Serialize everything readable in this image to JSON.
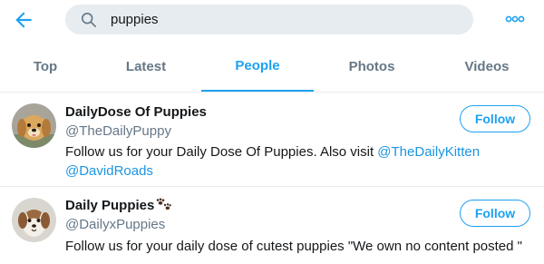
{
  "search": {
    "query": "puppies"
  },
  "tabs": [
    {
      "label": "Top"
    },
    {
      "label": "Latest"
    },
    {
      "label": "People",
      "active": true
    },
    {
      "label": "Photos"
    },
    {
      "label": "Videos"
    }
  ],
  "users": [
    {
      "name": "DailyDose Of Puppies",
      "handle": "@TheDailyPuppy",
      "bio_text": "Follow us for your Daily Dose Of Puppies. Also visit ",
      "bio_link_1": "@TheDailyKitten",
      "bio_link_2": "@DavidRoads",
      "follow_label": "Follow"
    },
    {
      "name": "Daily Puppies",
      "name_icon": "paw-prints-icon",
      "handle": "@DailyxPuppies",
      "bio_text": "Follow us for your daily dose of cutest puppies \"We own no content posted \"",
      "follow_label": "Follow"
    }
  ],
  "colors": {
    "accent": "#1da1f2",
    "link": "#1b95e0",
    "muted": "#657786",
    "search_bg": "#e6ecf0",
    "divider": "#e6ecf0",
    "text": "#14171a"
  }
}
